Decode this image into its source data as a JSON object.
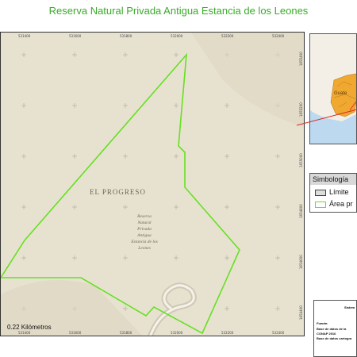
{
  "title": "Reserva Natural Privada Antigua Estancia de los Leones",
  "map": {
    "region_label": "EL PROGRESO",
    "reserve_label_lines": [
      "Reserva",
      "Natural",
      "Privada",
      "Antigua",
      "Estancia de los",
      "Leones"
    ],
    "coords_top": [
      "531400",
      "531600",
      "531800",
      "532000",
      "532200",
      "532400"
    ],
    "coords_bottom": [
      "531400",
      "531600",
      "531800",
      "532000",
      "532200",
      "532400"
    ],
    "coords_right": [
      "1655400",
      "1655200",
      "1655000",
      "1654800",
      "1654600",
      "1654400"
    ],
    "scale_text": "0.22 Kilómetros",
    "colors": {
      "boundary": "#66e022",
      "terrain": "#e7e2d0",
      "grid_cross": "#b9b3a3"
    }
  },
  "inset": {
    "label": "Guate",
    "colors": {
      "water": "#bcd9ef",
      "land": "#f3efe6",
      "highlight": "#f0a830",
      "pointer": "#e0241f"
    }
  },
  "legend": {
    "title": "Simbología",
    "items": [
      {
        "label": "Límite",
        "swatch_fill": "#dddddd",
        "swatch_border": "#444444"
      },
      {
        "label": "Área pr",
        "swatch_fill": "#ffffff",
        "swatch_border": "#66e022"
      }
    ]
  },
  "info": {
    "system": "Sistem",
    "source_label": "Fuente:",
    "lines": [
      "Base de datos de la",
      "CONAP 2016",
      "Base de datos cartogra"
    ]
  }
}
